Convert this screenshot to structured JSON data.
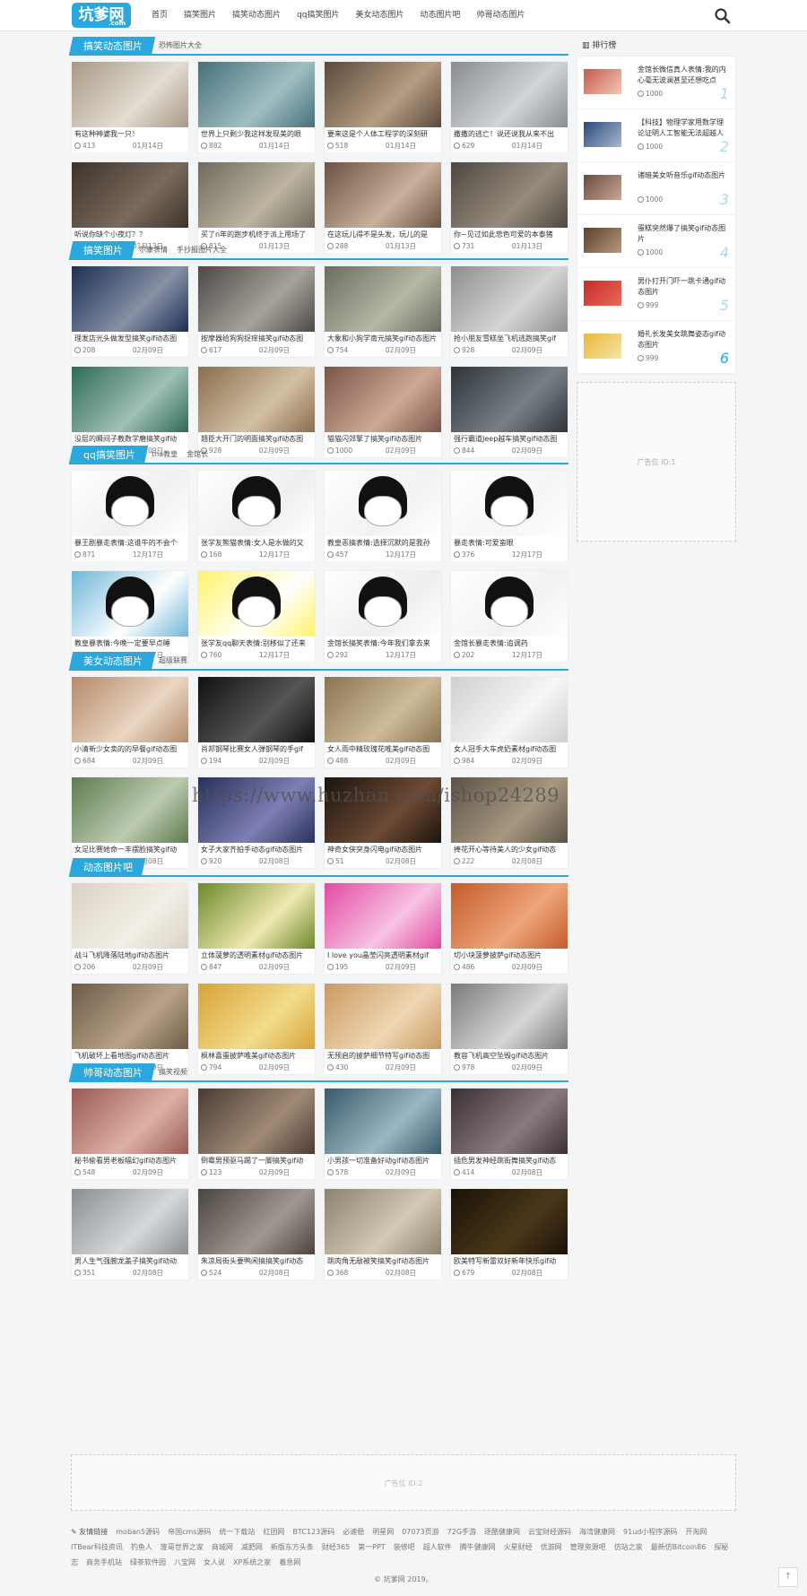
{
  "header": {
    "logo": "坑爹网",
    "logo_sub": ".com",
    "nav": [
      "首页",
      "搞笑图片",
      "搞笑动态图片",
      "qq搞笑图片",
      "美女动态图片",
      "动态图片吧",
      "帅哥动态图片"
    ]
  },
  "sections": [
    {
      "title": "搞笑动态图片",
      "tags": [
        "恐怖图片大全"
      ],
      "items": [
        {
          "t": "有这种神婆我一只！",
          "v": "413",
          "d": "01月14日",
          "c1": "#a89886",
          "c2": "#e3ddd2"
        },
        {
          "t": "世界上只剩少我这样发现美的眼",
          "v": "882",
          "d": "01月14日",
          "c1": "#46707a",
          "c2": "#9fbfc2"
        },
        {
          "t": "要来这是个人体工程学的深刻研",
          "v": "518",
          "d": "01月14日",
          "c1": "#5a4a3c",
          "c2": "#b59c82"
        },
        {
          "t": "撒撒的逃亡！说还说我从来不出",
          "v": "629",
          "d": "01月14日",
          "c1": "#8a8d90",
          "c2": "#d1d4d6"
        },
        {
          "t": "听说你缺个小夜灯？？",
          "v": "589",
          "d": "01月13日",
          "c1": "#3d322b",
          "c2": "#7a6a5c"
        },
        {
          "t": "买了n年的跑步机终于派上用场了",
          "v": "815",
          "d": "01月13日",
          "c1": "#6f6a5c",
          "c2": "#bdb4a1"
        },
        {
          "t": "在这玩儿得不是头发，玩儿的是",
          "v": "288",
          "d": "01月13日",
          "c1": "#6b5343",
          "c2": "#c8b09b"
        },
        {
          "t": "你~见过如此悲色可爱的本泰猪",
          "v": "731",
          "d": "01月13日",
          "c1": "#4f4840",
          "c2": "#968a7c"
        }
      ]
    },
    {
      "title": "搞笑图片",
      "tags": [
        "尔康表情",
        "手抄报图片大全"
      ],
      "items": [
        {
          "t": "理发店光头做发型搞笑gif动态图",
          "v": "208",
          "d": "02月09日",
          "c1": "#1d2f55",
          "c2": "#8791a5"
        },
        {
          "t": "按摩器给狗狗捉痒搞笑gif动态图",
          "v": "617",
          "d": "02月09日",
          "c1": "#4e4845",
          "c2": "#a8a29c"
        },
        {
          "t": "大象和小狗学南元搞笑gif动态图片",
          "v": "754",
          "d": "02月09日",
          "c1": "#6b6e5f",
          "c2": "#b4b8a6"
        },
        {
          "t": "抢小朋友雪糕坐飞机逃跑搞笑gif",
          "v": "928",
          "d": "02月09日",
          "c1": "#8e8e8e",
          "c2": "#d5d5d5"
        },
        {
          "t": "没层的瞬间子教数学磨搞笑gif动",
          "v": "937",
          "d": "02月09日",
          "c1": "#2e6a57",
          "c2": "#9fc1b4"
        },
        {
          "t": "翘臣大开门的明面搞笑gif动态图",
          "v": "928",
          "d": "02月09日",
          "c1": "#8a6e4d",
          "c2": "#d3c0a4"
        },
        {
          "t": "猫猫闪郊擎了搞笑gif动态图片",
          "v": "1000",
          "d": "02月09日",
          "c1": "#7a5548",
          "c2": "#cfa894"
        },
        {
          "t": "强行霸道Jeep越车搞笑gif动态图",
          "v": "844",
          "d": "02月09日",
          "c1": "#2e3438",
          "c2": "#788086"
        }
      ]
    },
    {
      "title": "qq搞笑图片",
      "tags": [
        "tna教皇",
        "金馆长"
      ],
      "items": [
        {
          "t": "暴王剧暴走表情:这谁牛的不会个",
          "v": "871",
          "d": "12月17日",
          "c1": "#ffffff",
          "c2": "#f0f0f0"
        },
        {
          "t": "张学友熊猫表情:女人是水做的又",
          "v": "168",
          "d": "12月17日",
          "c1": "#ffffff",
          "c2": "#eeeeee"
        },
        {
          "t": "教皇恶搞表情:选择沉默的是我孙",
          "v": "457",
          "d": "12月17日",
          "c1": "#ffffff",
          "c2": "#f2f2f2"
        },
        {
          "t": "暴走表情:可爱蛮眼",
          "v": "376",
          "d": "12月17日",
          "c1": "#ffffff",
          "c2": "#f5f5f5"
        },
        {
          "t": "教皇暴表情:今晚一定要早点睡",
          "v": "447",
          "d": "12月17日",
          "c1": "#6fb6d8",
          "c2": "#ffffff"
        },
        {
          "t": "张学友qq聊天表情:别移似了还来",
          "v": "760",
          "d": "12月17日",
          "c1": "#fff36a",
          "c2": "#ffffff"
        },
        {
          "t": "金馆长搞笑表情:今年我们拿去来",
          "v": "292",
          "d": "12月17日",
          "c1": "#ffffff",
          "c2": "#eeeeee"
        },
        {
          "t": "金馆长暴走表情:追调药",
          "v": "202",
          "d": "12月17日",
          "c1": "#ffffff",
          "c2": "#f2f2f2"
        }
      ]
    },
    {
      "title": "美女动态图片",
      "tags": [
        "超级联赛"
      ],
      "items": [
        {
          "t": "小清新少女卖的的早餐gif动态图",
          "v": "684",
          "d": "02月09日",
          "c1": "#b58a6a",
          "c2": "#e9d6c2"
        },
        {
          "t": "肖邦钢琴比赛女人弹钢琴的手gif",
          "v": "194",
          "d": "02月09日",
          "c1": "#111111",
          "c2": "#555555"
        },
        {
          "t": "女人雨中精玫瑰花唯美gif动态图",
          "v": "488",
          "d": "02月09日",
          "c1": "#8a7452",
          "c2": "#cdbb98"
        },
        {
          "t": "女人冠手大车虎奶素材gif动态图",
          "v": "984",
          "d": "02月09日",
          "c1": "#cfcfcf",
          "c2": "#f6f6f6"
        },
        {
          "t": "女足比赛她命一丰摆脸搞笑gif动",
          "v": "712",
          "d": "02月08日",
          "c1": "#5f7b4f",
          "c2": "#bccbb1"
        },
        {
          "t": "女子大家齐拍手动态gif动态图片",
          "v": "920",
          "d": "02月08日",
          "c1": "#27305a",
          "c2": "#7e7fb3"
        },
        {
          "t": "神奇女侠突身闪电gif动态图片",
          "v": "51",
          "d": "02月08日",
          "c1": "#1a1410",
          "c2": "#6e4a34"
        },
        {
          "t": "捧花开心等待美人的少女gif动态",
          "v": "222",
          "d": "02月08日",
          "c1": "#5c5246",
          "c2": "#a69880"
        }
      ]
    },
    {
      "title": "动态图片吧",
      "tags": [],
      "items": [
        {
          "t": "战斗飞机降落陆地gif动态图片",
          "v": "206",
          "d": "02月09日",
          "c1": "#d8d2c6",
          "c2": "#f4efe6"
        },
        {
          "t": "立体菠萝的透明素材gif动态图片",
          "v": "847",
          "d": "02月09日",
          "c1": "#6a8a2a",
          "c2": "#f0e8b0"
        },
        {
          "t": "I love you晶莹闪亮透明素材gif",
          "v": "195",
          "d": "02月09日",
          "c1": "#e24aa2",
          "c2": "#f7c3e3"
        },
        {
          "t": "切小块菠萝披萨gif动态图片",
          "v": "486",
          "d": "02月09日",
          "c1": "#c45a2a",
          "c2": "#eea57a"
        },
        {
          "t": "飞机破坏上看地图gif动态图片",
          "v": "49",
          "d": "02月09日",
          "c1": "#6e5a46",
          "c2": "#b8a28a"
        },
        {
          "t": "枫林喜蛋披萨唯美gif动态图片",
          "v": "794",
          "d": "02月09日",
          "c1": "#d8a23a",
          "c2": "#f2dc8a"
        },
        {
          "t": "无预启的披萨细节特写gif动态图",
          "v": "430",
          "d": "02月09日",
          "c1": "#c99a62",
          "c2": "#efd7b2"
        },
        {
          "t": "教容飞机高空坠毁gif动态图片",
          "v": "978",
          "d": "02月09日",
          "c1": "#7a7a7a",
          "c2": "#d6d6d6"
        }
      ]
    },
    {
      "title": "帅哥动态图片",
      "tags": [
        "搞笑视频"
      ],
      "items": [
        {
          "t": "秘书偷看男老板幅幻gif动态图片",
          "v": "548",
          "d": "02月09日",
          "c1": "#9a5a52",
          "c2": "#dcb0a6"
        },
        {
          "t": "倒霉男预驱马踢了一脚搞笑gif动",
          "v": "123",
          "d": "02月09日",
          "c1": "#4a3c34",
          "c2": "#a08a76"
        },
        {
          "t": "小男孩一切准备好动gif动态图片",
          "v": "578",
          "d": "02月09日",
          "c1": "#3a5a6a",
          "c2": "#9ab6c2"
        },
        {
          "t": "插危男发神经跳街舞搞笑gif动态",
          "v": "414",
          "d": "02月08日",
          "c1": "#3a3034",
          "c2": "#8a7a80"
        },
        {
          "t": "男人生气强腕龙盖子搞笑gif动动",
          "v": "351",
          "d": "02月08日",
          "c1": "#8a8e90",
          "c2": "#d4d8da"
        },
        {
          "t": "朱凉局街头要鸭闲搞搞笑gif动态",
          "v": "524",
          "d": "02月08日",
          "c1": "#4a4440",
          "c2": "#a09890"
        },
        {
          "t": "跳肉角无敌被笑搞笑gif动态图片",
          "v": "368",
          "d": "02月08日",
          "c1": "#8c8270",
          "c2": "#d2c8b4"
        },
        {
          "t": "欧美特写新雷双好新年快乐gif动",
          "v": "679",
          "d": "02月08日",
          "c1": "#1a1208",
          "c2": "#4a3818"
        }
      ]
    }
  ],
  "sidebar": {
    "title": "排行榜",
    "items": [
      {
        "t": "金馆长微信真人表情:我的内心毫无波澜甚至还想吃点",
        "v": "1000",
        "n": "1",
        "c1": "#c85a4a",
        "c2": "#f0c8b8"
      },
      {
        "t": "【科技】物理学家用数学理论证明人工智能无法超越人",
        "v": "1000",
        "n": "2",
        "c1": "#2a4a7a",
        "c2": "#a8b8d0"
      },
      {
        "t": "诸暗美女听音乐gif动态图片",
        "v": "1000",
        "n": "3",
        "c1": "#6a4a3a",
        "c2": "#c8a898"
      },
      {
        "t": "蛋糕突然爆了搞笑gif动态图片",
        "v": "1000",
        "n": "4",
        "c1": "#5a4030",
        "c2": "#b89878"
      },
      {
        "t": "男仆打开门吓一跳卡通gif动态图片",
        "v": "999",
        "n": "5",
        "c1": "#c82a2a",
        "c2": "#e86a5a"
      },
      {
        "t": "婚礼长发美女跳舞姿态gif动态图片",
        "v": "999",
        "n": "6",
        "c1": "#e8b83a",
        "c2": "#f6e4a8"
      }
    ]
  },
  "ads": {
    "side": "广告位 ID:1",
    "bottom": "广告位 ID:2"
  },
  "footer": {
    "label": "友情链接",
    "links": [
      "moban5源码",
      "帝国cms源码",
      "统一下载站",
      "红团网",
      "BTC123源码",
      "必速稳",
      "明星网",
      "07073页游",
      "72G手游",
      "逐酷健康网",
      "云宝财经源码",
      "海湾健康网",
      "91ud小程序源码",
      "开淘网",
      "ITBear科技资讯",
      "钓鱼人",
      "废哥世界之家",
      "商城网",
      "减肥网",
      "新版东方头条",
      "财经365",
      "第一PPT",
      "装修吧",
      "超人软件",
      "腾牛健康网",
      "火星财经",
      "优游网",
      "管理资源吧",
      "仿站之家",
      "最新仿Bitcoin86",
      "探秘志",
      "商务手机站",
      "绿茶软件园",
      "八宝网",
      "女人说",
      "XP系统之家",
      "着急网"
    ],
    "copyright": "© 坑爹网 2019。"
  },
  "watermark": "https://www.huzhan.com/ishop24289"
}
